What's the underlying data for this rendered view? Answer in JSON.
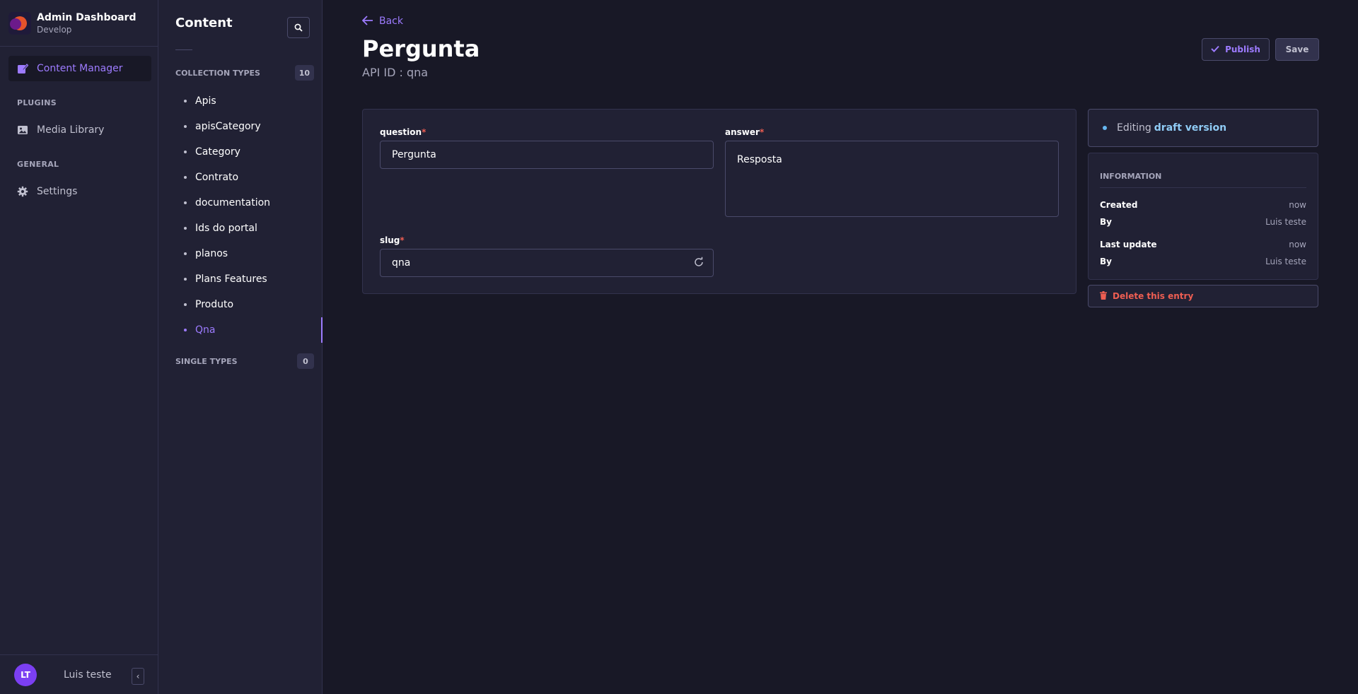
{
  "brand": {
    "title": "Admin Dashboard",
    "subtitle": "Develop"
  },
  "mainnav": {
    "content_manager": "Content Manager",
    "plugins_section": "PLUGINS",
    "media_library": "Media Library",
    "general_section": "GENERAL",
    "settings": "Settings"
  },
  "user": {
    "initials": "LT",
    "name": "Luis teste"
  },
  "subnav": {
    "title": "Content",
    "collection_types_label": "COLLECTION TYPES",
    "collection_types_count": "10",
    "collection_types": [
      "Apis",
      "apisCategory",
      "Category",
      "Contrato",
      "documentation",
      "Ids do portal",
      "planos",
      "Plans Features",
      "Produto",
      "Qna"
    ],
    "active_type": "Qna",
    "single_types_label": "SINGLE TYPES",
    "single_types_count": "0"
  },
  "header": {
    "back_label": "Back",
    "title": "Pergunta",
    "api_id": "API ID : qna",
    "publish_label": "Publish",
    "save_label": "Save"
  },
  "form": {
    "question": {
      "label": "question",
      "required_mark": "*",
      "value": "Pergunta"
    },
    "answer": {
      "label": "answer",
      "required_mark": "*",
      "value": "Resposta"
    },
    "slug": {
      "label": "slug",
      "required_mark": "*",
      "value": "qna"
    }
  },
  "sidebar": {
    "editing_prefix": "Editing",
    "editing_status": "draft version",
    "information_title": "INFORMATION",
    "rows": [
      {
        "key": "Created",
        "value": "now"
      },
      {
        "key": "By",
        "value": "Luis teste"
      },
      {
        "key": "Last update",
        "value": "now"
      },
      {
        "key": "By",
        "value": "Luis teste"
      }
    ],
    "delete_label": "Delete this entry"
  },
  "colors": {
    "accent": "#9d7bff",
    "danger": "#ee5e52",
    "background": "#181826",
    "panel": "#212134",
    "draft": "#8fcbf5"
  }
}
